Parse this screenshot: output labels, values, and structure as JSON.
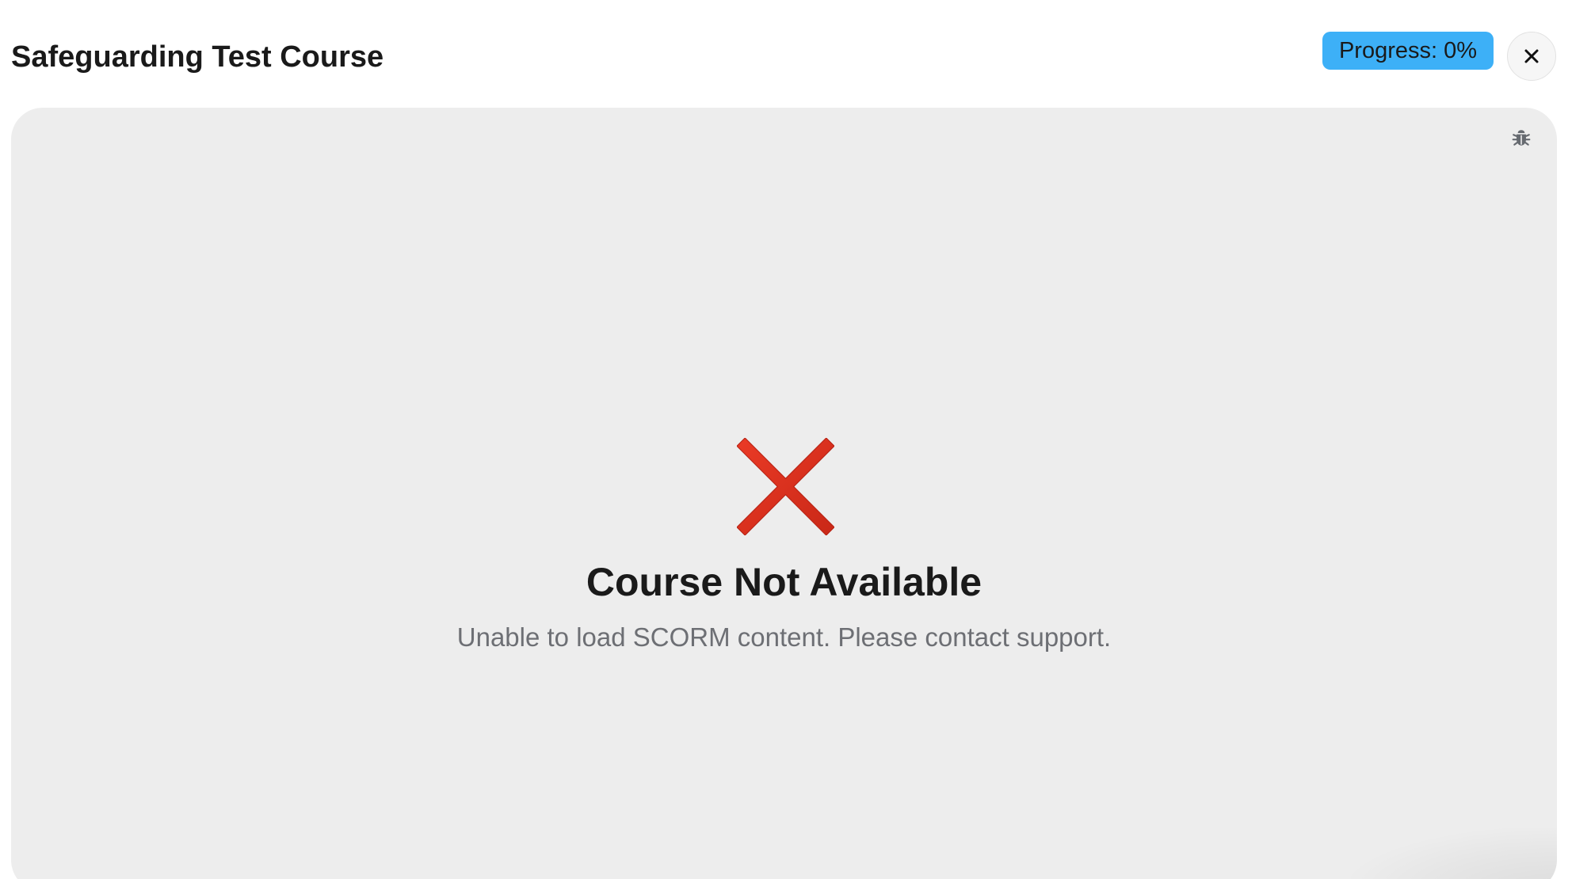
{
  "header": {
    "title": "Safeguarding Test Course",
    "progress_label": "Progress: 0%",
    "progress_value": 0,
    "close_icon": "close-icon",
    "progress_color": "#3db0f7"
  },
  "content": {
    "debug_icon": "bug-icon",
    "error_icon": "cross-mark-icon",
    "error_icon_color": "#d92b1d",
    "error_title": "Course Not Available",
    "error_message": "Unable to load SCORM content. Please contact support."
  }
}
